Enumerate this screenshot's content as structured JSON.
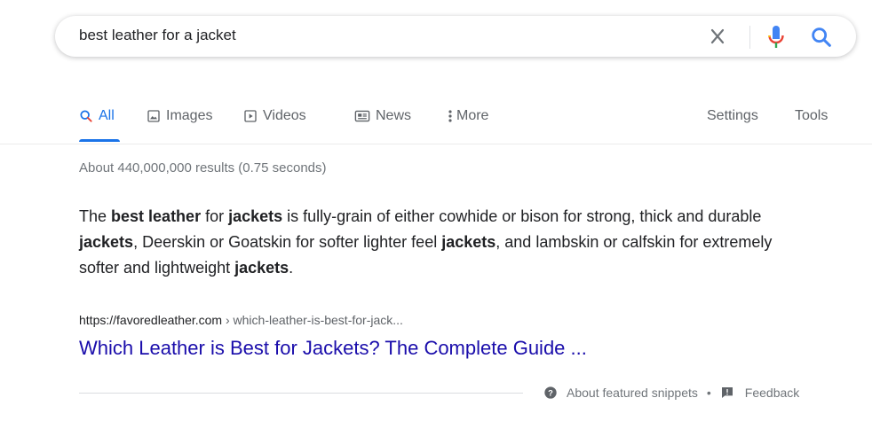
{
  "search": {
    "query": "best leather for a jacket",
    "clear_icon": "close-icon",
    "mic_icon": "mic-icon",
    "search_icon": "search-icon"
  },
  "tabs": [
    {
      "label": "All",
      "icon": "search-icon",
      "active": true
    },
    {
      "label": "Images",
      "icon": "image-icon",
      "active": false
    },
    {
      "label": "Videos",
      "icon": "play-icon",
      "active": false
    },
    {
      "label": "News",
      "icon": "news-icon",
      "active": false
    },
    {
      "label": "More",
      "icon": "more-vertical-icon",
      "active": false
    }
  ],
  "tools": {
    "settings": "Settings",
    "tools": "Tools"
  },
  "stats": "About 440,000,000 results (0.75 seconds)",
  "snippet": [
    {
      "text": "The ",
      "bold": false
    },
    {
      "text": "best leather",
      "bold": true
    },
    {
      "text": " for ",
      "bold": false
    },
    {
      "text": "jackets",
      "bold": true
    },
    {
      "text": " is fully-grain of either cowhide or bison for strong, thick and durable ",
      "bold": false
    },
    {
      "text": "jackets",
      "bold": true
    },
    {
      "text": ", Deerskin or Goatskin for softer lighter feel ",
      "bold": false
    },
    {
      "text": "jackets",
      "bold": true
    },
    {
      "text": ", and lambskin or calfskin for extremely softer and lightweight ",
      "bold": false
    },
    {
      "text": "jackets",
      "bold": true
    },
    {
      "text": ".",
      "bold": false
    }
  ],
  "result": {
    "domain": "https://favoredleather.com",
    "path": " › which-leather-is-best-for-jack...",
    "title": "Which Leather is Best for Jackets? The Complete Guide ..."
  },
  "footer": {
    "about": "About featured snippets",
    "separator": "•",
    "feedback": "Feedback"
  },
  "colors": {
    "accent": "#1a73e8",
    "link": "#1a0dab",
    "mic_red": "#ea4335",
    "mic_yellow": "#fbbc04",
    "mic_green": "#34a853"
  }
}
